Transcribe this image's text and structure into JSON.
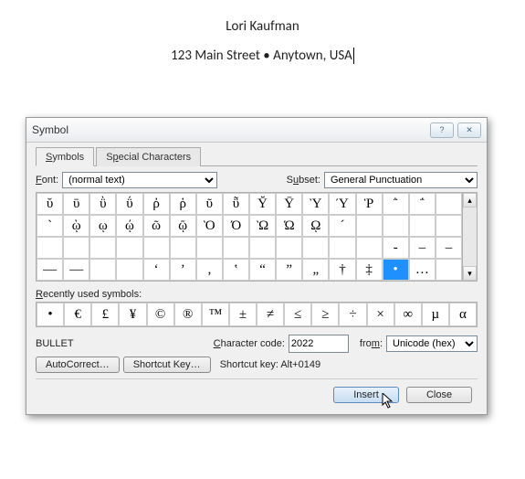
{
  "document": {
    "line1": "Lori Kaufman",
    "line2": "123 Main Street • Anytown, USA "
  },
  "dialog": {
    "title": "Symbol",
    "tabs": {
      "symbols": "Symbols",
      "special": "Special Characters"
    },
    "font_label": "Font:",
    "font_value": "(normal text)",
    "subset_label": "Subset:",
    "subset_value": "General Punctuation",
    "grid": [
      "ῠ",
      "ῡ",
      "ῢ",
      "ΰ",
      "ῤ",
      "ῥ",
      "ῦ",
      "ῧ",
      "Ῠ",
      "Ῡ",
      "Ὺ",
      "Ύ",
      "Ῥ",
      "῭",
      "΅",
      "",
      "`",
      "ῲ",
      "ῳ",
      "ῴ",
      "ῶ",
      "ῷ",
      "Ὸ",
      "Ό",
      "Ὼ",
      "Ώ",
      "ῼ",
      "´",
      "",
      "",
      "",
      "",
      "",
      "",
      "",
      "",
      "",
      "",
      "",
      "",
      "",
      "",
      "",
      "",
      "",
      "‐",
      "‒",
      "–",
      "—",
      "―",
      "",
      "",
      "‘",
      "’",
      "‚",
      "‛",
      "“",
      "”",
      "„",
      "†",
      "‡",
      "•",
      "…",
      ""
    ],
    "selected_index": 61,
    "recent_label": "Recently used symbols:",
    "recent": [
      "•",
      "€",
      "£",
      "¥",
      "©",
      "®",
      "™",
      "±",
      "≠",
      "≤",
      "≥",
      "÷",
      "×",
      "∞",
      "µ",
      "α"
    ],
    "charname": "BULLET",
    "charcode_label": "Character code:",
    "charcode_value": "2022",
    "from_label": "from:",
    "from_value": "Unicode (hex)",
    "autocorrect": "AutoCorrect…",
    "shortcutkey": "Shortcut Key…",
    "shortcut_label": "Shortcut key: Alt+0149",
    "insert": "Insert",
    "close": "Close"
  }
}
